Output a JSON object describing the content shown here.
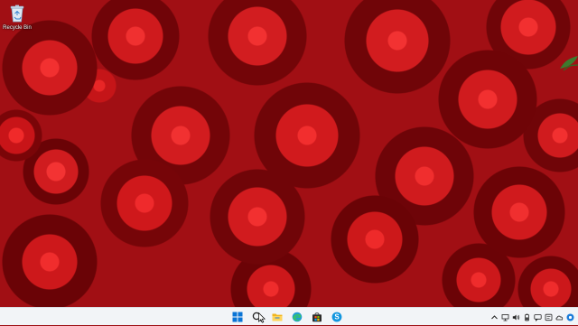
{
  "desktop": {
    "wallpaper": "red-roses",
    "icons": [
      {
        "label": "Recycle Bin",
        "icon": "recycle-bin-icon"
      }
    ]
  },
  "taskbar": {
    "apps": [
      {
        "name": "start",
        "icon": "windows-logo-icon"
      },
      {
        "name": "search",
        "icon": "search-icon"
      },
      {
        "name": "file-explorer",
        "icon": "folder-icon"
      },
      {
        "name": "edge",
        "icon": "edge-icon"
      },
      {
        "name": "store",
        "icon": "store-icon"
      },
      {
        "name": "skype",
        "icon": "skype-icon",
        "label": "S"
      }
    ],
    "tray": [
      {
        "name": "show-hidden",
        "icon": "chevron-up-icon"
      },
      {
        "name": "network",
        "icon": "network-icon"
      },
      {
        "name": "volume",
        "icon": "speaker-icon"
      },
      {
        "name": "battery",
        "icon": "battery-icon"
      },
      {
        "name": "meet-now",
        "icon": "chat-icon"
      },
      {
        "name": "notification",
        "icon": "notification-icon"
      },
      {
        "name": "onedrive",
        "icon": "cloud-icon"
      },
      {
        "name": "help",
        "icon": "help-icon"
      }
    ]
  },
  "colors": {
    "taskbar_bg": "#f2f4f7",
    "accent": "#0078d4",
    "wallpaper_red": "#c81418"
  }
}
